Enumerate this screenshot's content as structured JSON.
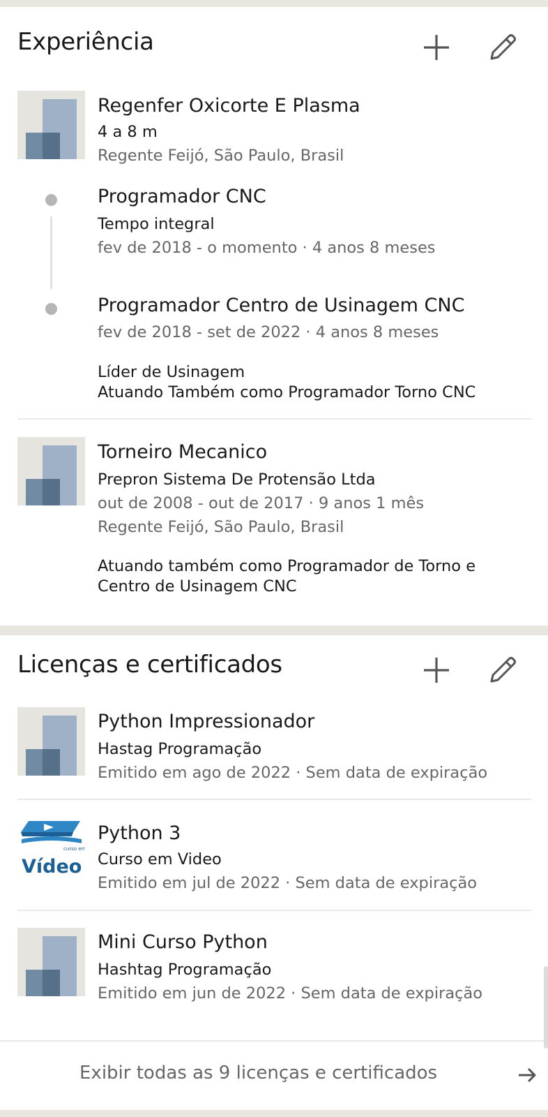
{
  "experience": {
    "title": "Experiência",
    "company_group": {
      "company": "Regenfer Oxicorte E Plasma",
      "duration": "4 a 8 m",
      "location": "Regente Feijó, São Paulo, Brasil",
      "roles": [
        {
          "title": "Programador CNC",
          "type": "Tempo integral",
          "dates": "fev de 2018 - o momento · 4 anos 8 meses"
        },
        {
          "title": "Programador Centro de Usinagem CNC",
          "dates": "fev de 2018 - set de 2022 · 4 anos 8 meses",
          "description": [
            "Líder de Usinagem",
            "Atuando Também como Programador Torno CNC"
          ]
        }
      ]
    },
    "entry": {
      "title": "Torneiro Mecanico",
      "company": "Prepron Sistema De Protensão Ltda",
      "dates": "out de 2008 - out de 2017 · 9 anos 1 mês",
      "location": "Regente Feijó, São Paulo, Brasil",
      "description": [
        "Atuando também como Programador de Torno e",
        "Centro de Usinagem CNC"
      ]
    }
  },
  "licenses": {
    "title": "Licenças e certificados",
    "items": [
      {
        "title": "Python Impressionador",
        "issuer": "Hastag Programação",
        "issued": "Emitido em ago de 2022 · Sem data de expiração",
        "logo": "placeholder-company-logo"
      },
      {
        "title": "Python 3",
        "issuer": "Curso em Video",
        "issued": "Emitido em jul de 2022 · Sem data de expiração",
        "logo": "curso-em-video-logo",
        "logo_text": "Vídeo",
        "logo_small_text": "curso em"
      },
      {
        "title": "Mini Curso Python",
        "issuer": "Hashtag Programação",
        "issued": "Emitido em jun de 2022 · Sem data de expiração",
        "logo": "placeholder-company-logo"
      }
    ],
    "show_all": "Exibir todas as 9 licenças e certificados"
  },
  "icons": {
    "add": "plus-icon",
    "edit": "pencil-icon",
    "show_all": "arrow-right-icon"
  },
  "colors": {
    "background": "#e9e5df",
    "card": "#ffffff",
    "primary_text": "#191919",
    "secondary_text": "#666666",
    "logo_light": "#9fb1c6",
    "logo_mid": "#728ba4",
    "logo_dark": "#56708a"
  }
}
